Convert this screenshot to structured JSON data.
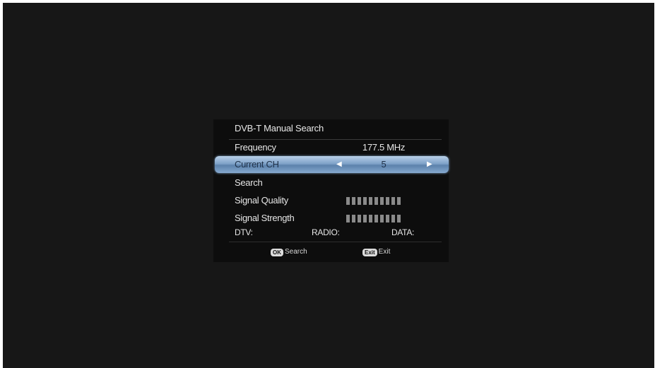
{
  "menu": {
    "title": "DVB-T Manual Search",
    "frequency": {
      "label": "Frequency",
      "value": "177.5 MHz"
    },
    "current_ch": {
      "label": "Current CH",
      "value": "5",
      "left_arrow_icon": "triangle-left-icon",
      "right_arrow_icon": "triangle-right-icon"
    },
    "search": {
      "label": "Search"
    },
    "signal_quality": {
      "label": "Signal Quality",
      "level": 0
    },
    "signal_strength": {
      "label": "Signal Strength",
      "level": 0
    },
    "counts": {
      "dtv": "DTV:",
      "radio": "RADIO:",
      "data": "DATA:"
    }
  },
  "hints": {
    "ok_key": "OK",
    "ok_label": "Search",
    "exit_key": "Exit",
    "exit_label": "Exit"
  },
  "colors": {
    "background": "#171717",
    "panel": "#0d0d0d",
    "highlight": "#7fa2c8",
    "bar": "#8a8a8a"
  }
}
